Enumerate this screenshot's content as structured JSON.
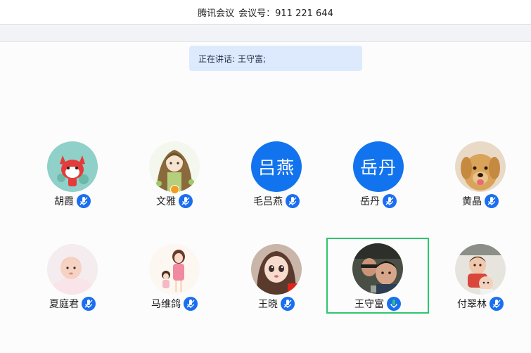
{
  "window": {
    "app_name": "腾讯会议",
    "meeting_id_label": "会议号：911 221 644"
  },
  "speaking": {
    "label": "正在讲话:",
    "speaker": "王守富;"
  },
  "colors": {
    "accent": "#1273ee",
    "mic_active": "#2ec66d",
    "speaking_bg": "#ddeafe"
  },
  "participants": [
    {
      "name": "胡霞",
      "avatar": "cartoon-fox",
      "mic": "idle"
    },
    {
      "name": "文雅",
      "avatar": "cartoon-girl",
      "mic": "idle",
      "badge": "host-icon"
    },
    {
      "name": "毛吕燕",
      "avatar_text": "吕燕",
      "mic": "idle"
    },
    {
      "name": "岳丹",
      "avatar_text": "岳丹",
      "mic": "idle"
    },
    {
      "name": "黄晶",
      "avatar": "dog-photo",
      "mic": "idle"
    },
    {
      "name": "夏庭君",
      "avatar": "baby-photo",
      "mic": "idle"
    },
    {
      "name": "马维鸽",
      "avatar": "cartoon-mother-daughter",
      "mic": "idle"
    },
    {
      "name": "王晓",
      "avatar": "cartoon-doll",
      "mic": "idle"
    },
    {
      "name": "王守富",
      "avatar": "selfie-photo",
      "mic": "speaking",
      "active": true
    },
    {
      "name": "付翠林",
      "avatar": "children-photo",
      "mic": "idle"
    }
  ]
}
